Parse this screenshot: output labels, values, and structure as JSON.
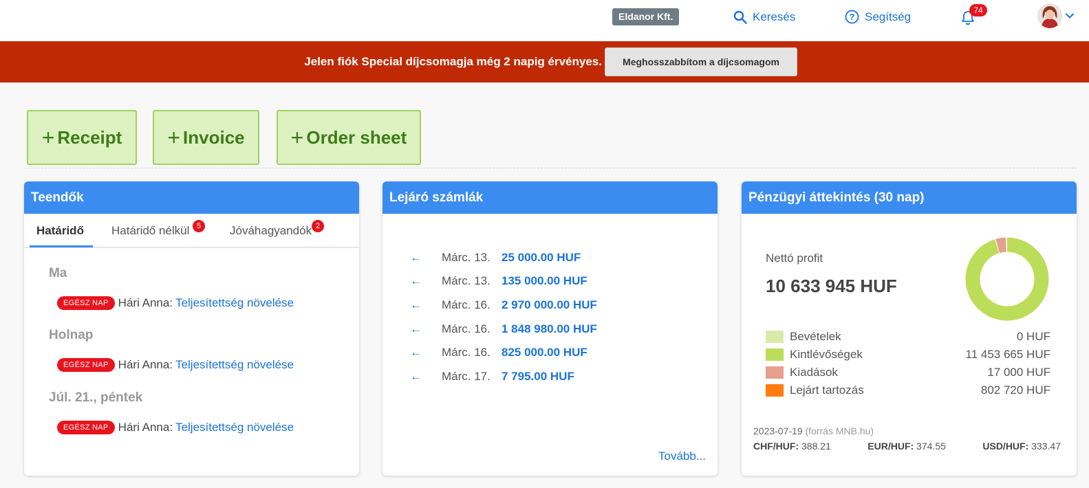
{
  "topbar": {
    "company": "Eldanor Kft.",
    "search_label": "Keresés",
    "help_label": "Segítség",
    "notification_count": "74"
  },
  "banner": {
    "text": "Jelen fiók Special díjcsomagja még 2 napig érvényes.",
    "button_label": "Meghosszabbítom a díjcsomagom"
  },
  "quick_actions": [
    {
      "label": "Receipt"
    },
    {
      "label": "Invoice"
    },
    {
      "label": "Order sheet"
    }
  ],
  "todo": {
    "title": "Teendők",
    "tabs": [
      {
        "label": "Határidő",
        "badge": ""
      },
      {
        "label": "Határidő nélkül",
        "badge": "5"
      },
      {
        "label": "Jóváhagyandók",
        "badge": "2"
      }
    ],
    "groups": [
      {
        "day": "Ma",
        "pill": "EGÉSZ NAP",
        "person": "Hári Anna:",
        "task": "Teljesítettség növelése"
      },
      {
        "day": "Holnap",
        "pill": "EGÉSZ NAP",
        "person": "Hári Anna:",
        "task": "Teljesítettség növelése"
      },
      {
        "day": "Júl. 21., péntek",
        "pill": "EGÉSZ NAP",
        "person": "Hári Anna:",
        "task": "Teljesítettség növelése"
      }
    ]
  },
  "invoices": {
    "title": "Lejáró számlák",
    "rows": [
      {
        "date": "Márc. 13.",
        "amount": "25 000.00 HUF"
      },
      {
        "date": "Márc. 13.",
        "amount": "135 000.00 HUF"
      },
      {
        "date": "Márc. 16.",
        "amount": "2 970 000.00 HUF"
      },
      {
        "date": "Márc. 16.",
        "amount": "1 848 980.00 HUF"
      },
      {
        "date": "Márc. 16.",
        "amount": "825 000.00 HUF"
      },
      {
        "date": "Márc. 17.",
        "amount": "7 795.00 HUF"
      }
    ],
    "more_label": "Tovább..."
  },
  "finance": {
    "title": "Pénzügyi áttekintés (30 nap)",
    "net_label": "Nettó profit",
    "net_value": "10 633 945 HUF",
    "legend": [
      {
        "label": "Bevételek",
        "value": "0 HUF",
        "color": "#d9eba8"
      },
      {
        "label": "Kintlévőségek",
        "value": "11 453 665 HUF",
        "color": "#bcdd5a"
      },
      {
        "label": "Kiadások",
        "value": "17 000 HUF",
        "color": "#e8a08e"
      },
      {
        "label": "Lejárt tartozás",
        "value": "802 720 HUF",
        "color": "#ff7d10"
      }
    ],
    "donut_fractions": {
      "receivables": 0.955,
      "expenses": 0.045
    },
    "rate_date": "2023-07-19",
    "rate_source": "(forrás MNB.hu)",
    "rates": [
      {
        "pair": "CHF/HUF:",
        "value": "388.21"
      },
      {
        "pair": "EUR/HUF:",
        "value": "374.55"
      },
      {
        "pair": "USD/HUF:",
        "value": "333.47"
      }
    ]
  }
}
